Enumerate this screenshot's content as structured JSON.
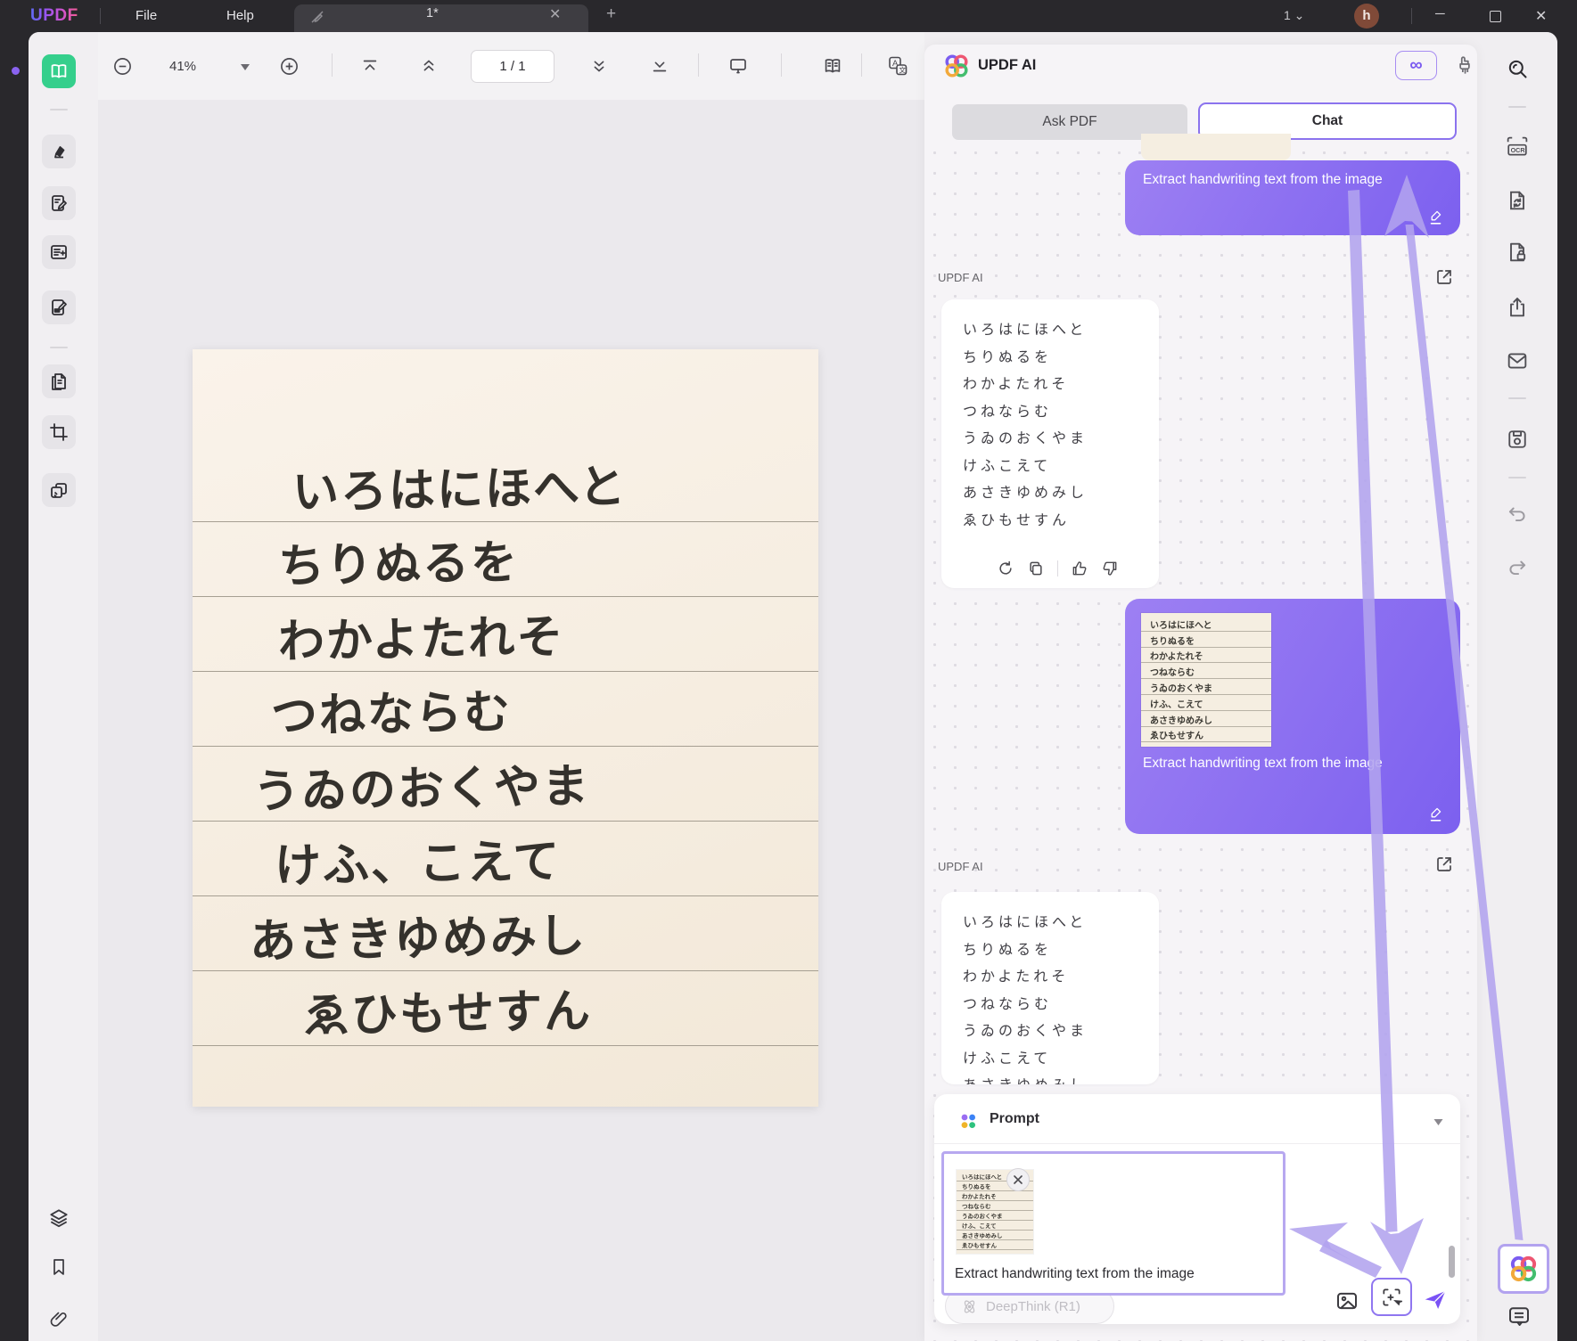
{
  "window": {
    "app_name": "UPDF",
    "menus": [
      "File",
      "Help"
    ],
    "tab_label": "1*",
    "page_indicator": "1",
    "avatar_initial": "h"
  },
  "toolbar": {
    "zoom_level": "41%",
    "page_display": "1 / 1"
  },
  "left_toolbar_icons": [
    "reader-mode",
    "highlighter",
    "annotate",
    "organize-pages",
    "fill-sign",
    "page-copy",
    "crop",
    "watermark",
    "layers",
    "bookmark",
    "attachment"
  ],
  "right_rail_icons": [
    "search",
    "ocr",
    "convert-pdf",
    "protect-pdf",
    "share",
    "email",
    "save",
    "undo",
    "redo",
    "updf-ai",
    "comment"
  ],
  "paper": {
    "lines": [
      "いろはにほへと",
      "ちりぬるを",
      "わかよたれそ",
      "つねならむ",
      "うゐのおくやま",
      "けふ、こえて",
      "あさきゆめみし",
      "ゑひもせすん"
    ]
  },
  "ai_panel": {
    "title": "UPDF AI",
    "tabs": {
      "ask_pdf": "Ask PDF",
      "chat": "Chat"
    },
    "sender_label": "UPDF AI",
    "sender_label_2": "UPDF AI",
    "user_message": "Extract handwriting text from the image",
    "user_message_2": "Extract handwriting text from the image",
    "response_lines": [
      "いろはにほへと",
      "ちりぬるを",
      "わかよたれそ",
      "つねならむ",
      "うゐのおくやま",
      "けふこえて",
      "あさきゆめみし",
      "ゑひもせすん"
    ],
    "message_actions": [
      "regenerate",
      "copy",
      "thumbs-up",
      "thumbs-down"
    ],
    "prompt": {
      "label": "Prompt",
      "attachment_caption": "Extract handwriting text from the image",
      "deepthink_label": "DeepThink (R1)"
    }
  },
  "colors": {
    "accent_purple": "#7c5cf0",
    "bubble_gradient": [
      "#9d80f3",
      "#7c60ef"
    ],
    "active_tool_green": "#35cf8c",
    "arrow_lavender": "#b3a4ee"
  }
}
